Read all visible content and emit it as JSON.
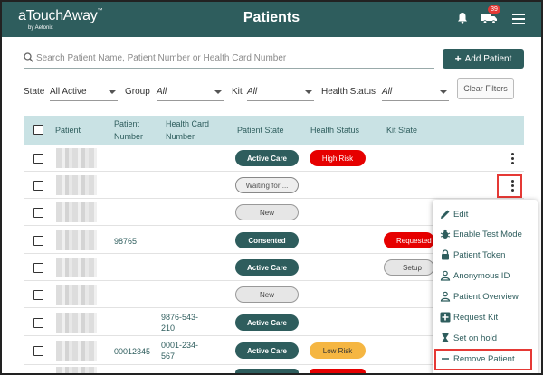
{
  "app": {
    "logo_main": "aTouchAway",
    "logo_tm": "™",
    "logo_sub": "by Aetonix",
    "title": "Patients"
  },
  "header": {
    "notification_count": "39"
  },
  "search": {
    "placeholder": "Search Patient Name, Patient Number or Health Card Number"
  },
  "actions": {
    "add_patient": "Add Patient",
    "clear_filters": "Clear Filters"
  },
  "filters": {
    "state_label": "State",
    "state_value": "All Active",
    "group_label": "Group",
    "group_value": "All",
    "kit_label": "Kit",
    "kit_value": "All",
    "health_label": "Health Status",
    "health_value": "All"
  },
  "table": {
    "headers": {
      "patient": "Patient",
      "patient_number_1": "Patient",
      "patient_number_2": "Number",
      "health_card_1": "Health Card",
      "health_card_2": "Number",
      "patient_state": "Patient State",
      "health_status": "Health Status",
      "kit_state": "Kit State"
    },
    "rows": [
      {
        "patient_number": "",
        "health_card_1": "",
        "health_card_2": "",
        "state": "Active Care",
        "health": "High Risk",
        "kit": ""
      },
      {
        "patient_number": "",
        "health_card_1": "",
        "health_card_2": "",
        "state": "Waiting for ...",
        "health": "",
        "kit": ""
      },
      {
        "patient_number": "",
        "health_card_1": "",
        "health_card_2": "",
        "state": "New",
        "health": "",
        "kit": ""
      },
      {
        "patient_number": "98765",
        "health_card_1": "",
        "health_card_2": "",
        "state": "Consented",
        "health": "",
        "kit": "Requested"
      },
      {
        "patient_number": "",
        "health_card_1": "",
        "health_card_2": "",
        "state": "Active Care",
        "health": "",
        "kit": "Setup"
      },
      {
        "patient_number": "",
        "health_card_1": "",
        "health_card_2": "",
        "state": "New",
        "health": "",
        "kit": ""
      },
      {
        "patient_number": "",
        "health_card_1": "9876-543-",
        "health_card_2": "210",
        "state": "Active Care",
        "health": "",
        "kit": ""
      },
      {
        "patient_number": "00012345",
        "health_card_1": "0001-234-",
        "health_card_2": "567",
        "state": "Active Care",
        "health": "Low Risk",
        "kit": ""
      }
    ]
  },
  "menu": {
    "items": [
      "Edit",
      "Enable Test Mode",
      "Patient Token",
      "Anonymous ID",
      "Patient Overview",
      "Request Kit",
      "Set on hold",
      "Remove Patient"
    ]
  },
  "colors": {
    "primary": "#2e5d5d",
    "header_row": "#c9e2e4",
    "danger": "#e60000",
    "warning": "#f5b642",
    "highlight": "#e53935"
  }
}
